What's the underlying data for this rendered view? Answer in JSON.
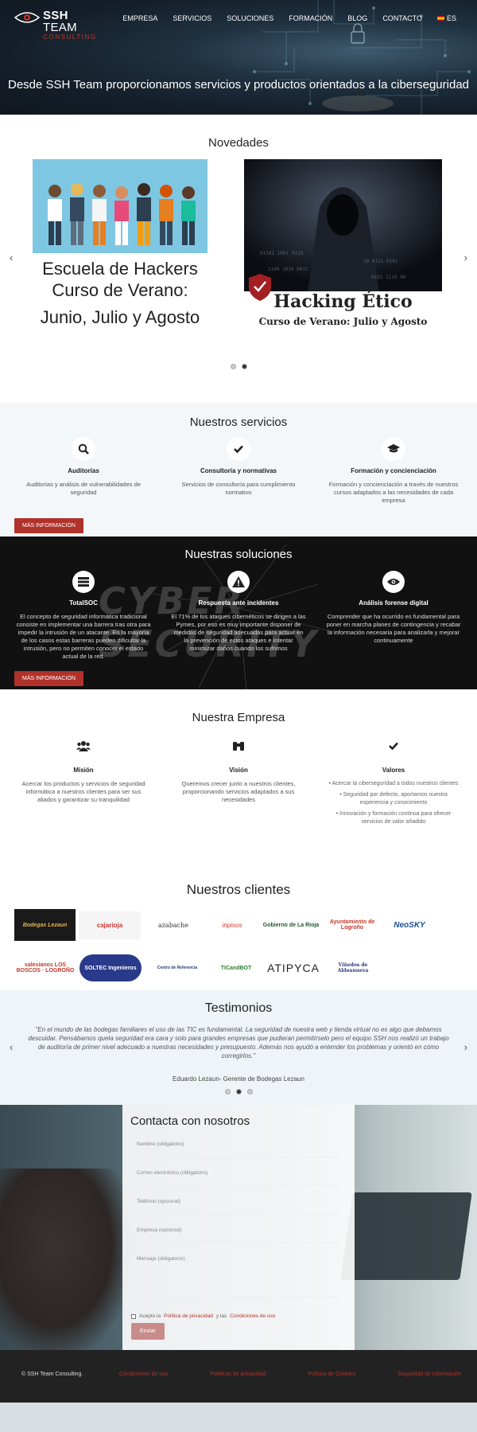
{
  "header": {
    "logo_main": "SSH",
    "logo_team": "TEAM",
    "logo_sub": "CONSULTING",
    "nav": [
      "EMPRESA",
      "SERVICIOS",
      "SOLUCIONES",
      "FORMACIÓN",
      "BLOG",
      "CONTACTO"
    ],
    "lang": "ES",
    "tagline": "Desde SSH Team proporcionamos servicios y productos orientados a la ciberseguridad"
  },
  "novedades": {
    "title": "Novedades",
    "card1": {
      "line1": "Escuela de Hackers",
      "line2": "Curso de Verano:",
      "line3": "Junio, Julio y Agosto"
    },
    "card2": {
      "line1": "Hacking Ético",
      "line2": "Curso de Verano: Julio y Agosto"
    },
    "prev": "‹",
    "next": "›"
  },
  "servicios": {
    "title": "Nuestros servicios",
    "items": [
      {
        "title": "Auditorías",
        "desc": "Auditorías y análisis de vulnerabilidades de seguridad",
        "icon": "search-icon"
      },
      {
        "title": "Consultoría y normativas",
        "desc": "Servicios de consultoría para cumplimiento normativo",
        "icon": "check-icon"
      },
      {
        "title": "Formación y concienciación",
        "desc": "Formación y concienciación a través de nuestros cursos adaptados a las necesidades de cada empresa",
        "icon": "graduation-cap-icon"
      }
    ],
    "button": "MÁS INFORMACIÓN"
  },
  "soluciones": {
    "title": "Nuestras soluciones",
    "bg_word": "CYBER SECURITY",
    "items": [
      {
        "title": "TotalSOC",
        "desc": "El concepto de seguridad informática tradicional consiste en implementar una barrera tras otra para impedir la intrusión de un atacante. En la mayoría de los casos estas barreras pueden dificultar la intrusión, pero no permiten conocer el estado actual de la red.",
        "icon": "server-icon"
      },
      {
        "title": "Respuesta ante incidentes",
        "desc": "El 71% de los ataques cibernéticos se dirigen a las Pymes, por eso es muy importante disponer de medidas de seguridad adecuadas para actuar en la prevención de estos ataques e intentar minimizar daños cuando los sufrimos",
        "icon": "warning-icon"
      },
      {
        "title": "Análisis forense digital",
        "desc": "Comprender que ha ocurrido es fundamental para poner en marcha planes de contingencia y recabar la información necesaria para analizarla y mejorar continuamente",
        "icon": "eye-icon"
      }
    ],
    "button": "MÁS INFORMACIÓN"
  },
  "empresa": {
    "title": "Nuestra Empresa",
    "mision": {
      "title": "Misión",
      "desc": "Acercar los productos y servicios de seguridad informática a nuestros clientes para ser sus aliados y garantizar su tranquilidad"
    },
    "vision": {
      "title": "Visión",
      "desc": "Queremos crecer junto a nuestros clientes, proporcionando servicios adaptados a sus necesidades"
    },
    "valores": {
      "title": "Valores",
      "items": [
        "Acercar la ciberseguridad a todos nuestros clientes",
        "Seguridad por defecto, aportamos nuestra experiencia y conocimiento",
        "Innovación y formación continua para ofrecer servicios de valor añadido"
      ]
    }
  },
  "clientes": {
    "title": "Nuestros clientes",
    "row1": [
      "Bodegas Lezaun",
      "cajarioja",
      "azabache",
      "inpisos",
      "Gobierno de La Rioja",
      "Ayuntamiento de Logroño",
      "NeoSKY"
    ],
    "row2": [
      "salesianos LOS BOSCOS · LOGROÑO",
      "SOLTEC Ingenieros",
      "Centro de Referencia",
      "TICandBOT",
      "ATIPYCA",
      "Viñedos de Aldeanueva"
    ]
  },
  "testimonios": {
    "title": "Testimonios",
    "quote": "\"En el mundo de las bodegas familiares el uso de las TIC es fundamental. La seguridad de nuestra web y tienda virtual no es algo que debamos descuidar. Pensábamos quela seguridad era cara y solo para grandes empresas que pudieran permitírselo pero el equipo SSH nos realizó un trabajo de auditoría de primer nivel adecuado a nuestras necesidades y presupuesto. Además nos ayudó a entender los problemas y orientó en cómo corregirlos.\"",
    "author": "Eduardo Lezaun- Gerente de Bodegas Lezaun"
  },
  "contacto": {
    "title": "Contacta con nosotros",
    "fields": [
      "Nombre (obligatorio)",
      "Correo electrónico (obligatorio)",
      "Teléfono (opcional)",
      "Empresa (opcional)",
      "Mensaje (obligatorio)"
    ],
    "consent_pre": "Acepto la ",
    "consent_link1": "Política de privacidad",
    "consent_mid": " y las ",
    "consent_link2": "Condiciones de uso",
    "send": "Enviar"
  },
  "footer": {
    "copy": "© SSH Team Consulting.",
    "links": [
      "Condiciones de uso",
      "Políticas de privacidad",
      "Política de Cookies",
      "Seguridad de información"
    ]
  },
  "colors": {
    "accent": "#b0322b",
    "dark": "#111111",
    "light_bg": "#f3f7f9"
  }
}
